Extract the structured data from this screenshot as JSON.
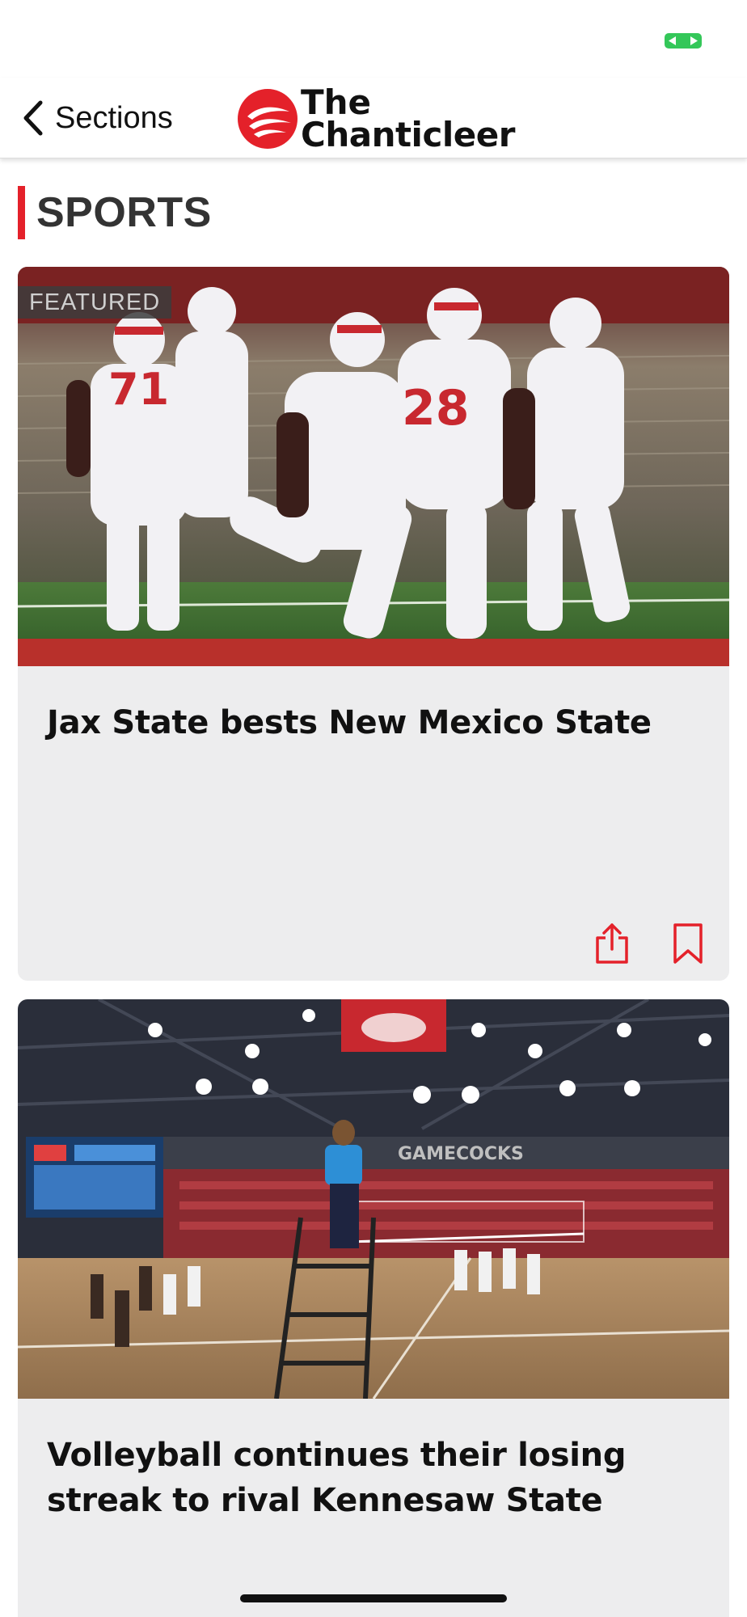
{
  "nav": {
    "back_label": "Sections",
    "logo_line1": "The",
    "logo_line2": "Chanticleer"
  },
  "section": {
    "title": "SPORTS"
  },
  "articles": [
    {
      "badge": "FEATURED",
      "title": "Jax State bests New Mexico State",
      "image_desc": "football players in white uniforms celebrating on field",
      "actions": [
        "share-icon",
        "bookmark-icon"
      ]
    },
    {
      "title": "Volleyball continues their losing streak to rival Kennesaw State",
      "image_desc": "volleyball match in indoor arena"
    }
  ],
  "colors": {
    "accent": "#e4212a",
    "battery": "#34c759",
    "card_bg": "#ededee"
  }
}
